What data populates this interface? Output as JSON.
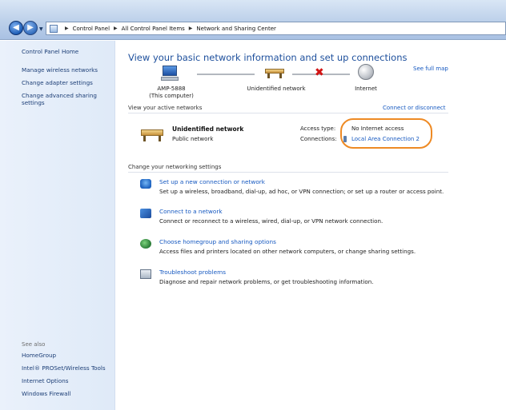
{
  "address_bar": {
    "crumbs": [
      "Control Panel",
      "All Control Panel Items",
      "Network and Sharing Center"
    ]
  },
  "left_pane": {
    "links": [
      "Control Panel Home",
      "Manage wireless networks",
      "Change adapter settings",
      "Change advanced sharing settings"
    ],
    "see_also_label": "See also",
    "see_also_links": [
      "HomeGroup",
      "Intel® PROSet/Wireless Tools",
      "Internet Options",
      "Windows Firewall"
    ]
  },
  "main": {
    "title": "View your basic network information and set up connections",
    "see_full_map": "See full map",
    "map": {
      "computer_label": "AMP-5888",
      "computer_sublabel": "(This computer)",
      "network_label": "Unidentified network",
      "internet_label": "Internet"
    },
    "active_networks_label": "View your active networks",
    "connect_disconnect": "Connect or disconnect",
    "active_network": {
      "name": "Unidentified network",
      "type": "Public network",
      "access_type_label": "Access type:",
      "access_type_value": "No Internet access",
      "connections_label": "Connections:",
      "connections_value": "Local Area Connection 2"
    },
    "change_settings_label": "Change your networking settings",
    "tasks": [
      {
        "title": "Set up a new connection or network",
        "desc": "Set up a wireless, broadband, dial-up, ad hoc, or VPN connection; or set up a router or access point.",
        "icon": "network-setup-icon"
      },
      {
        "title": "Connect to a network",
        "desc": "Connect or reconnect to a wireless, wired, dial-up, or VPN network connection.",
        "icon": "connect-network-icon"
      },
      {
        "title": "Choose homegroup and sharing options",
        "desc": "Access files and printers located on other network computers, or change sharing settings.",
        "icon": "homegroup-icon"
      },
      {
        "title": "Troubleshoot problems",
        "desc": "Diagnose and repair network problems, or get troubleshooting information.",
        "icon": "troubleshoot-icon"
      }
    ]
  },
  "colors": {
    "link": "#1558c0",
    "title": "#1d4f9c",
    "highlight": "#ee8a24",
    "error_x": "#d21414"
  }
}
